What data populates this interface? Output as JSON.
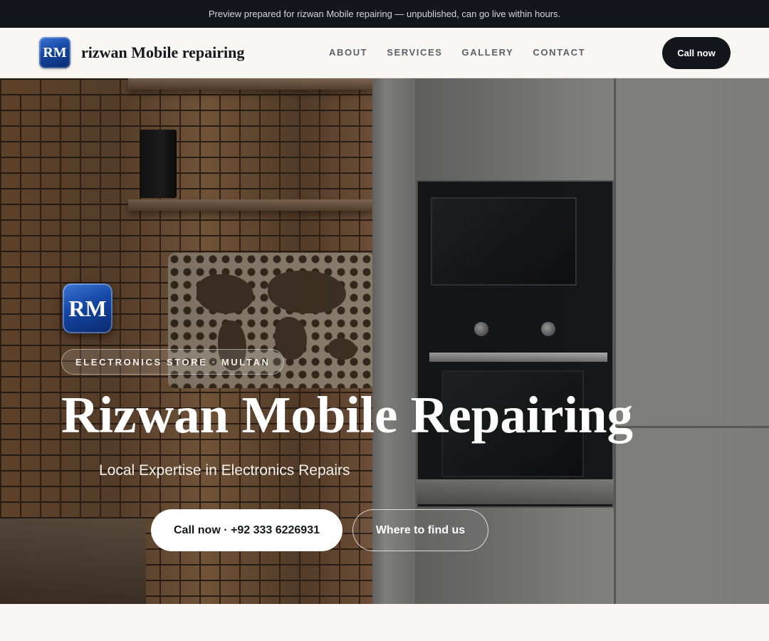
{
  "banner": {
    "text": "Preview prepared for rizwan Mobile repairing — unpublished, can go live within hours."
  },
  "header": {
    "logo_initials": "RM",
    "brand_name": "rizwan Mobile repairing",
    "nav": [
      {
        "label": "ABOUT"
      },
      {
        "label": "SERVICES"
      },
      {
        "label": "GALLERY"
      },
      {
        "label": "CONTACT"
      }
    ],
    "cta_label": "Call now"
  },
  "hero": {
    "logo_initials": "RM",
    "tag": "ELECTRONICS STORE · MULTAN",
    "title": "Rizwan Mobile Repairing",
    "subtitle": "Local Expertise in Electronics Repairs",
    "primary_button": "Call now · +92 333 6226931",
    "secondary_button": "Where to find us"
  },
  "colors": {
    "dark": "#13161b",
    "page_bg": "#f8f7f4",
    "logo_blue": "#1446a3",
    "nav_text": "#5a5f68"
  }
}
